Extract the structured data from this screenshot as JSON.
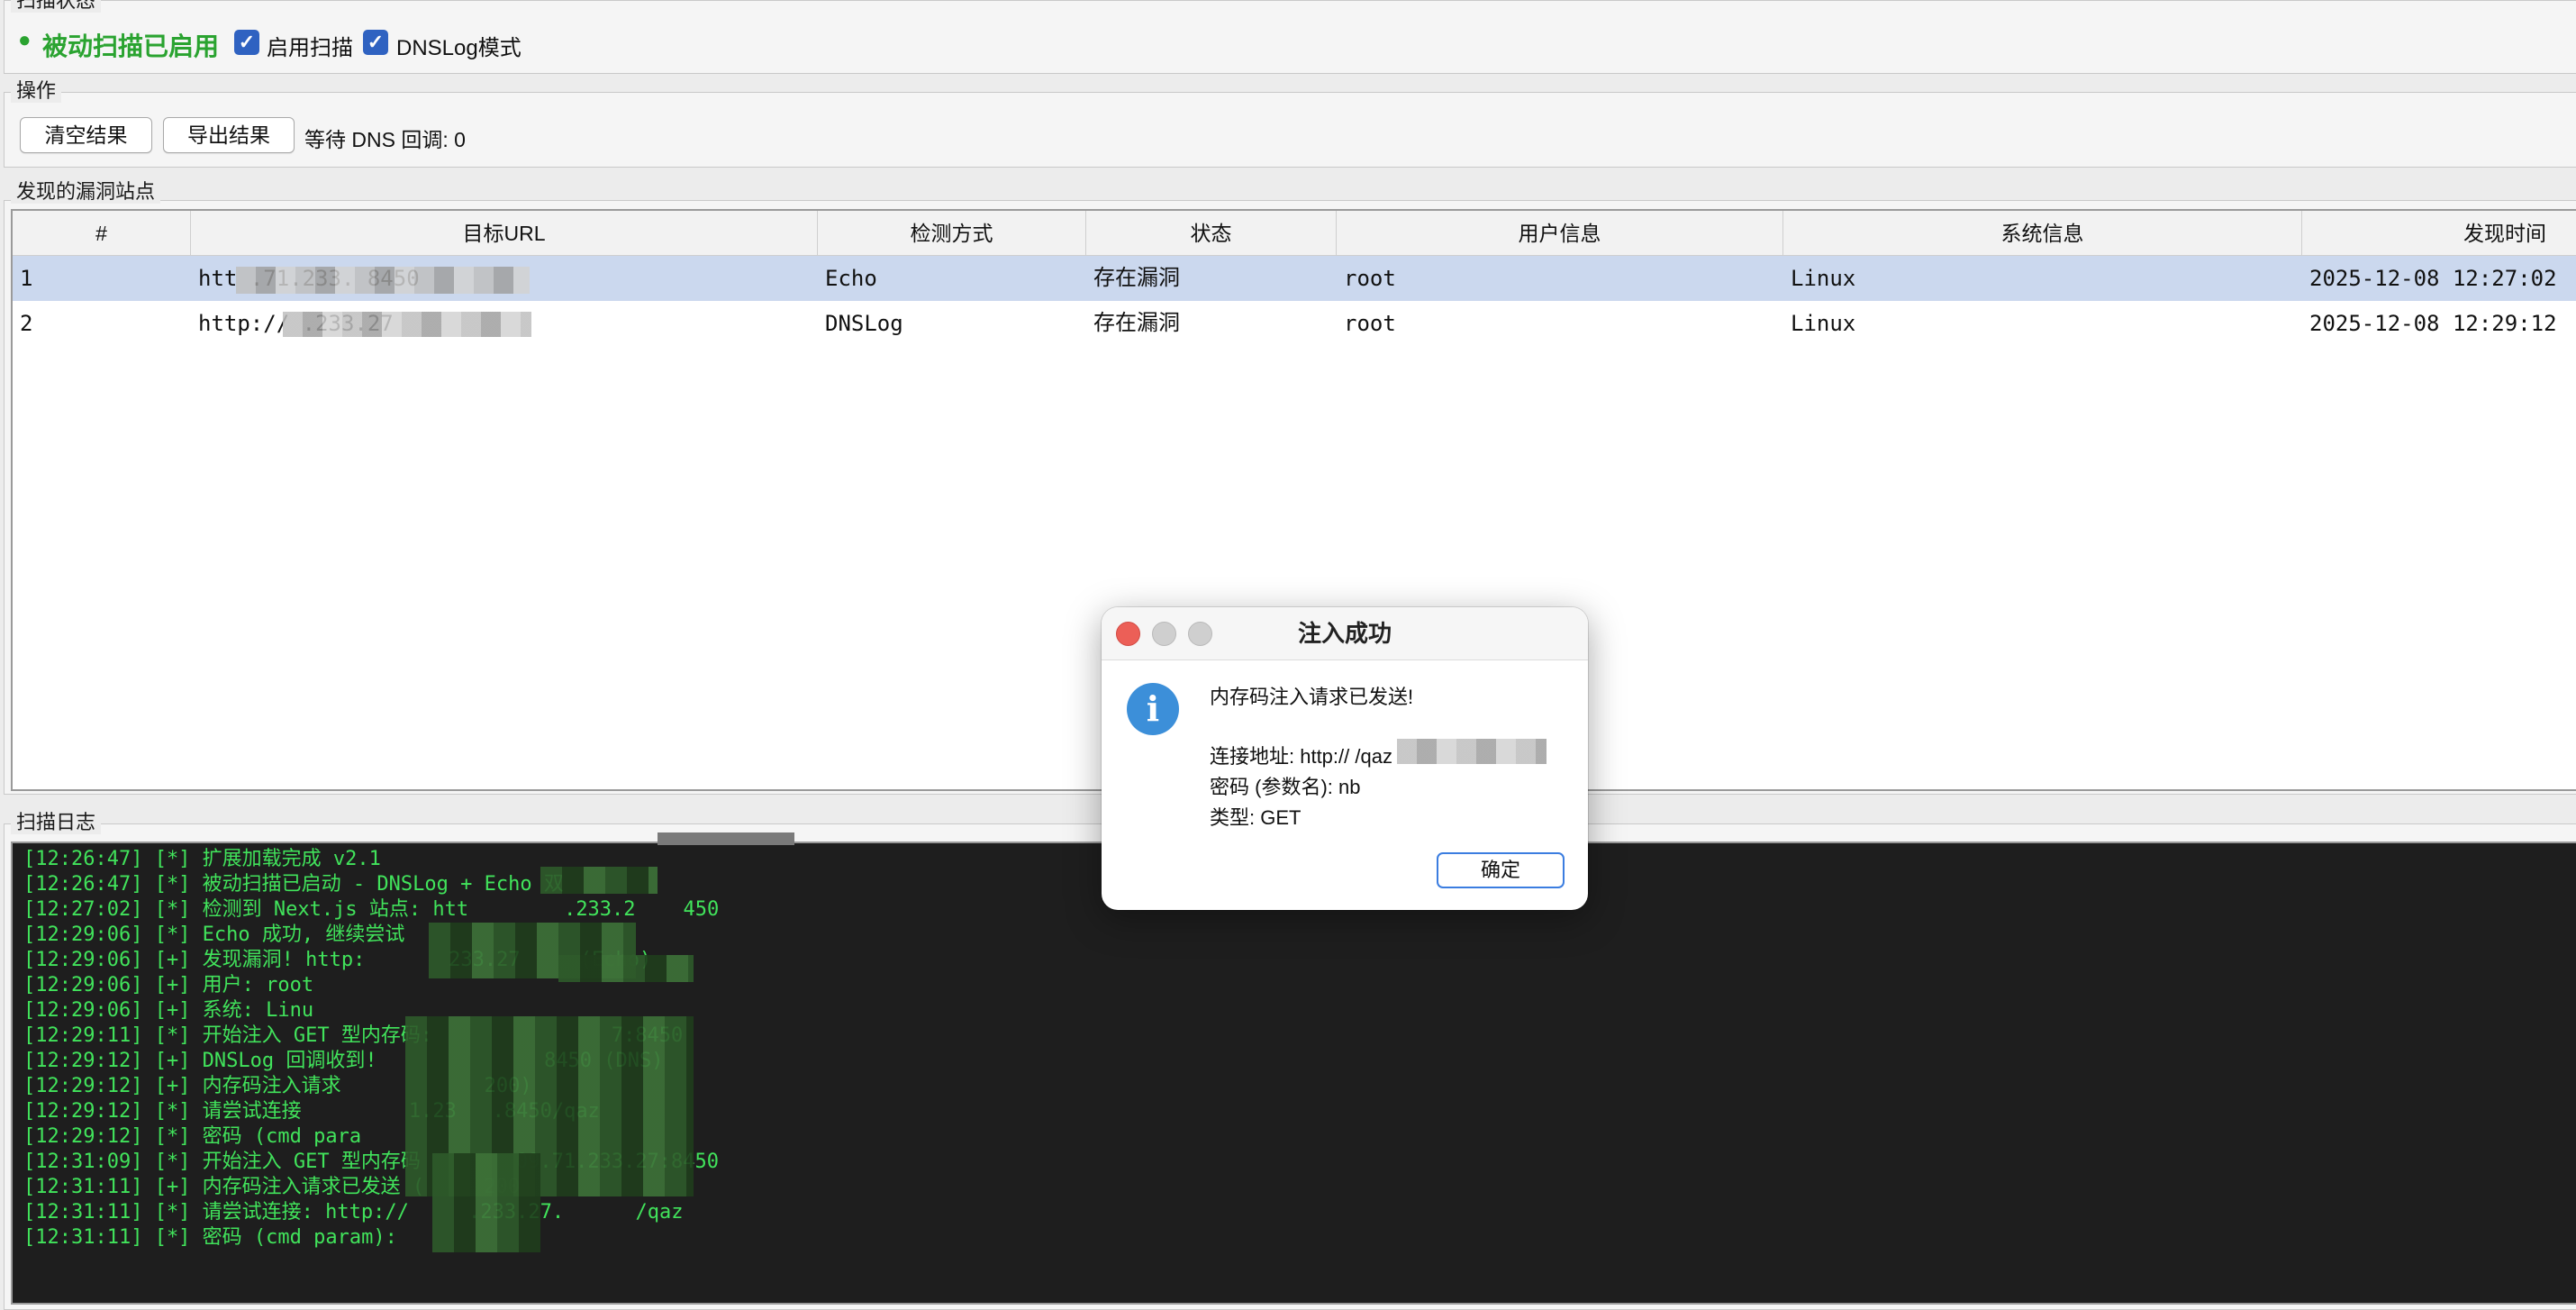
{
  "status_group": {
    "title": "扫描状态",
    "status_text": "被动扫描已启用",
    "checkbox_scan_label": "启用扫描",
    "checkbox_dnslog_label": "DNSLog模式"
  },
  "ops_group": {
    "title": "操作",
    "clear_button": "清空结果",
    "export_button": "导出结果",
    "pending_text": "等待 DNS 回调: 0"
  },
  "vuln_group": {
    "title": "发现的漏洞站点",
    "columns": [
      "#",
      "目标URL",
      "检测方式",
      "状态",
      "用户信息",
      "系统信息",
      "发现时间"
    ],
    "rows": [
      {
        "no": "1",
        "url": "htt               .71.233.    8450",
        "method": "Echo",
        "state": "存在漏洞",
        "user": "root",
        "system": "Linux",
        "time": "2025-12-08 12:27:02"
      },
      {
        "no": "2",
        "url": "http://            .233.27       ",
        "method": "DNSLog",
        "state": "存在漏洞",
        "user": "root",
        "system": "Linux",
        "time": "2025-12-08 12:29:12"
      }
    ]
  },
  "log_group": {
    "title": "扫描日志",
    "lines": [
      "[12:26:47] [*] 扩展加载完成 v2.1",
      "[12:26:47] [*] 被动扫描已启动 - DNSLog + Echo 双",
      "[12:27:02] [*] 检测到 Next.js 站点: htt        .233.2    450",
      "[12:29:06] [*] Echo 成功, 继续尝试",
      "[12:29:06] [+] 发现漏洞! http:       233.27     (Echo)",
      "[12:29:06] [+] 用户: root",
      "[12:29:06] [+] 系统: Linu",
      "[12:29:11] [*] 开始注入 GET 型内存码:               7:8450",
      "[12:29:12] [+] DNSLog 回调收到!              8450 (DNS)",
      "[12:29:12] [+] 内存码注入请求            200)",
      "[12:29:12] [*] 请尝试连接         1.23   .8450/qaz",
      "[12:29:12] [*] 密码 (cmd para",
      "[12:31:09] [*] 开始注入 GET 型内存码        09.71.233.27:8450",
      "[12:31:11] [+] 内存码注入请求已发送 (     200",
      "[12:31:11] [*] 请尝试连接: http://     .233.27.      /qaz",
      "[12:31:11] [*] 密码 (cmd param):"
    ]
  },
  "dialog": {
    "title": "注入成功",
    "message": "内存码注入请求已发送!",
    "connect_line": "连接地址: http://               /qaz",
    "password_line": "密码 (参数名): nb",
    "type_line": "类型: GET",
    "ok_button": "确定",
    "colors": {
      "close": "#ec5f57",
      "minimize": "#c9c9c9",
      "zoom": "#c9c9c9",
      "accent": "#3b7de0"
    }
  },
  "icons": {
    "checkbox": "checkmark-icon",
    "dialog": "info-icon",
    "status": "green-dot-icon"
  }
}
